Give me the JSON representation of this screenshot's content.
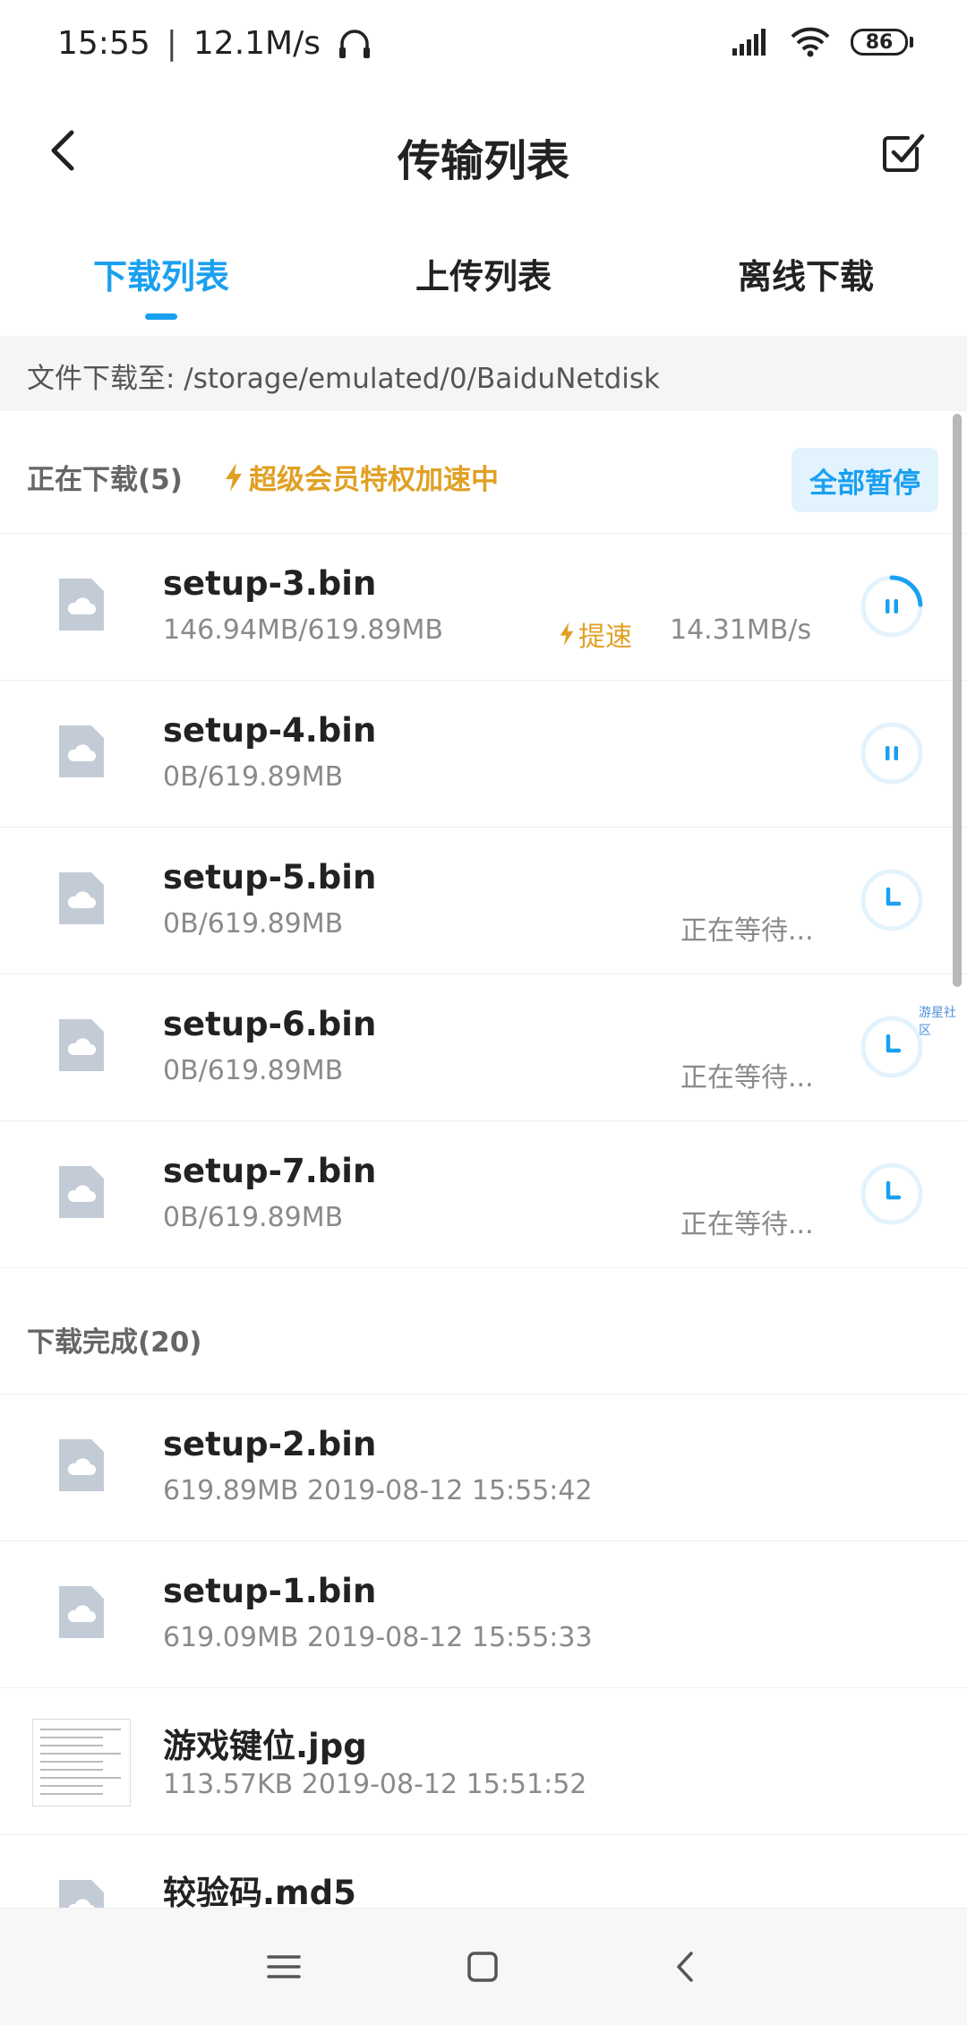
{
  "status": {
    "time": "15:55",
    "separator": "|",
    "net_speed": "12.1M/s",
    "battery": "86"
  },
  "header": {
    "title": "传输列表"
  },
  "tabs": [
    {
      "label": "下载列表",
      "active": true
    },
    {
      "label": "上传列表",
      "active": false
    },
    {
      "label": "离线下载",
      "active": false
    }
  ],
  "path": {
    "text": "文件下载至: /storage/emulated/0/BaiduNetdisk"
  },
  "downloading": {
    "title": "正在下载(5)",
    "vip": "超级会员特权加速中",
    "pause_all": "全部暂停",
    "items": [
      {
        "name": "setup-3.bin",
        "meta": "146.94MB/619.89MB",
        "speedup": "提速",
        "speed": "14.31MB/s",
        "status": "",
        "state": "downloading",
        "progress": 0.24
      },
      {
        "name": "setup-4.bin",
        "meta": "0B/619.89MB",
        "speedup": "",
        "speed": "",
        "status": "",
        "state": "paused-ready",
        "progress": 0
      },
      {
        "name": "setup-5.bin",
        "meta": "0B/619.89MB",
        "speedup": "",
        "speed": "",
        "status": "正在等待...",
        "state": "waiting",
        "progress": 0
      },
      {
        "name": "setup-6.bin",
        "meta": "0B/619.89MB",
        "speedup": "",
        "speed": "",
        "status": "正在等待...",
        "state": "waiting",
        "progress": 0
      },
      {
        "name": "setup-7.bin",
        "meta": "0B/619.89MB",
        "speedup": "",
        "speed": "",
        "status": "正在等待...",
        "state": "waiting",
        "progress": 0
      }
    ]
  },
  "completed": {
    "title": "下载完成(20)",
    "items": [
      {
        "name": "setup-2.bin",
        "meta": "619.89MB 2019-08-12 15:55:42",
        "kind": "file"
      },
      {
        "name": "setup-1.bin",
        "meta": "619.09MB 2019-08-12 15:55:33",
        "kind": "file"
      },
      {
        "name": "游戏键位.jpg",
        "meta": "113.57KB 2019-08-12 15:51:52",
        "kind": "image"
      },
      {
        "name": "较验码.md5",
        "meta": "",
        "kind": "file"
      }
    ]
  },
  "watermark": "游星社区",
  "colors": {
    "accent": "#1aa0f0",
    "vip": "#e0a024",
    "icon_gray": "#c3ccd6"
  }
}
